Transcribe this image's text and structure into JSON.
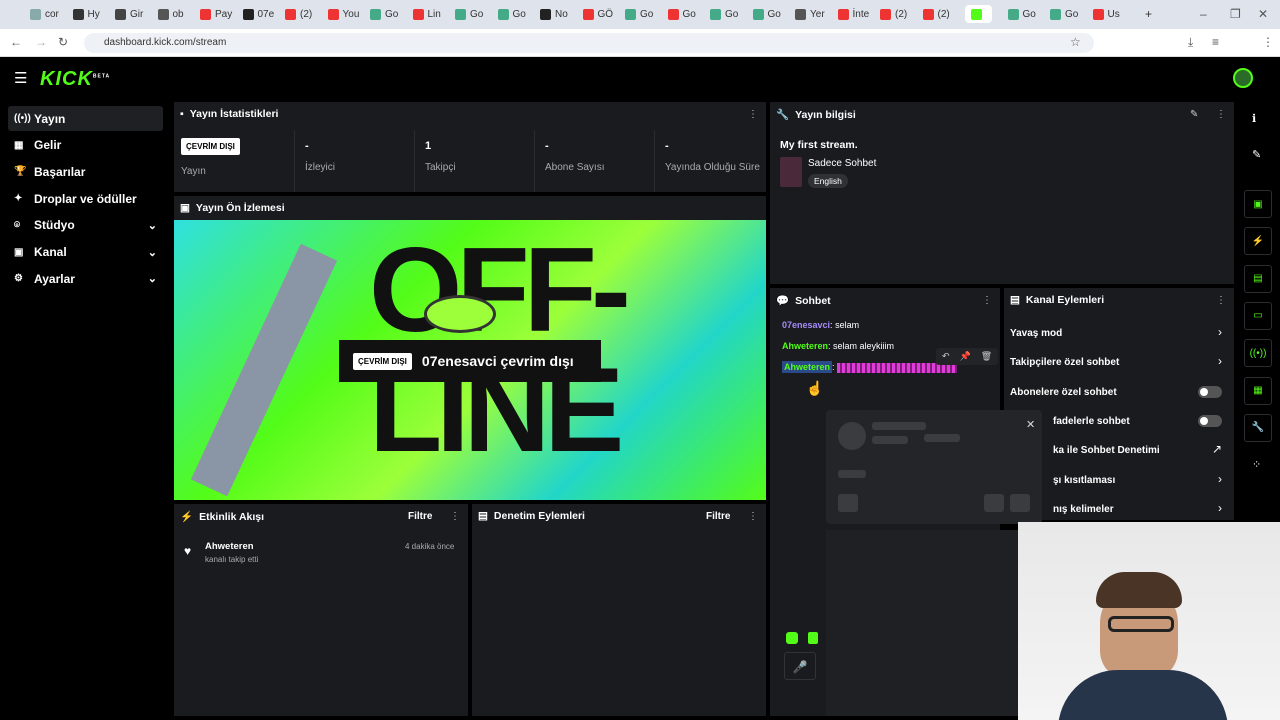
{
  "browser": {
    "tabs": [
      "cor",
      "Hy",
      "Gir",
      "ob",
      "Pay",
      "07e",
      "(2)",
      "You",
      "Go",
      "Lin",
      "Go",
      "Go",
      "No",
      "GÖ",
      "Go",
      "Go",
      "Go",
      "Go",
      "Yer",
      "İnte",
      "(2)",
      "(2)",
      "",
      "Go",
      "Go",
      "Us"
    ],
    "url": "dashboard.kick.com/stream",
    "profile_letter": "M"
  },
  "kick": {
    "logo": "KICK",
    "logo_tag": "BETA"
  },
  "sidebar": {
    "items": [
      {
        "label": "Yayın",
        "icon": "broadcast-icon"
      },
      {
        "label": "Gelir",
        "icon": "revenue-icon"
      },
      {
        "label": "Başarılar",
        "icon": "trophy-icon"
      },
      {
        "label": "Droplar ve ödüller",
        "icon": "gift-icon"
      },
      {
        "label": "Stüdyo",
        "icon": "studio-icon"
      },
      {
        "label": "Kanal",
        "icon": "channel-icon"
      },
      {
        "label": "Ayarlar",
        "icon": "gear-icon"
      }
    ]
  },
  "stats": {
    "title": "Yayın İstatistikleri",
    "status_badge": "ÇEVRİM DIŞI",
    "status_label": "Yayın",
    "items": [
      {
        "value": "-",
        "label": "İzleyici"
      },
      {
        "value": "1",
        "label": "Takipçi"
      },
      {
        "value": "-",
        "label": "Abone Sayısı"
      },
      {
        "value": "-",
        "label": "Yayında Olduğu Süre"
      }
    ]
  },
  "streaminfo": {
    "title": "Yayın bilgisi",
    "stream_title": "My first stream.",
    "category": "Sadece Sohbet",
    "language": "English"
  },
  "preview": {
    "title": "Yayın Ön İzlemesi",
    "badge": "ÇEVRİM DIŞI",
    "text": "07enesavci çevrim dışı",
    "bg_text": "OFF-LINE"
  },
  "chat": {
    "title": "Sohbet",
    "messages": [
      {
        "user": "07enesavci",
        "text": "selam",
        "color": "#a78bfa"
      },
      {
        "user": "Ahweteren",
        "text": "selam aleykiiim",
        "color": "#53fc18"
      },
      {
        "user": "Ahweteren",
        "text": "",
        "color": "#53fc18"
      }
    ]
  },
  "actions": {
    "title": "Kanal Eylemleri",
    "items": [
      {
        "label": "Yavaş mod",
        "control": "arrow"
      },
      {
        "label": "Takipçilere özel sohbet",
        "control": "arrow"
      },
      {
        "label": "Abonelere özel sohbet",
        "control": "toggle"
      },
      {
        "label": "fadelerle sohbet",
        "control": "toggle"
      },
      {
        "label": "ka ile Sohbet Denetimi",
        "control": "external"
      },
      {
        "label": "şı kısıtlaması",
        "control": "arrow"
      },
      {
        "label": "nış kelimeler",
        "control": "arrow"
      }
    ]
  },
  "activity": {
    "title": "Etkinlik Akışı",
    "filter": "Filtre",
    "events": [
      {
        "user": "Ahweteren",
        "action": "kanalı takip etti",
        "time": "4 dakika önce"
      }
    ]
  },
  "moderation": {
    "title": "Denetim Eylemleri",
    "filter": "Filtre"
  }
}
